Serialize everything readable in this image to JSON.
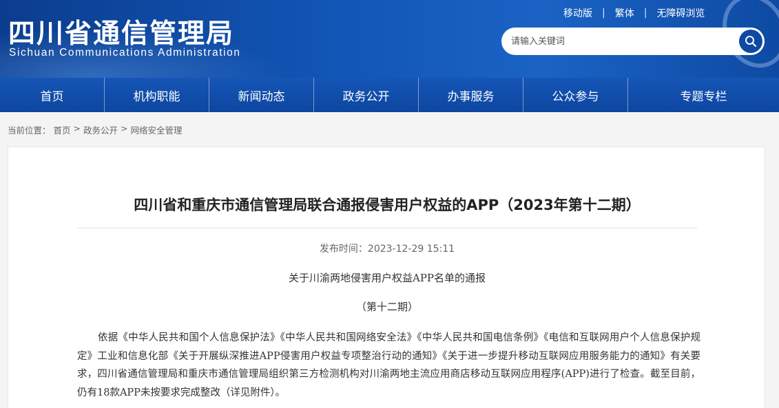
{
  "header": {
    "logo_cn": "四川省通信管理局",
    "logo_en": "Sichuan Communications Administration",
    "toplinks": [
      "移动版",
      "繁体",
      "无障碍浏览"
    ],
    "search_placeholder": "请输入关键词"
  },
  "nav": {
    "items": [
      "首页",
      "机构职能",
      "新闻动态",
      "政务公开",
      "办事服务",
      "公众参与",
      "专题专栏"
    ]
  },
  "breadcrumb": {
    "label": "当前位置：",
    "items": [
      "首页",
      "政务公开",
      "网络安全管理"
    ],
    "separator": ">"
  },
  "article": {
    "title": "四川省和重庆市通信管理局联合通报侵害用户权益的APP（2023年第十二期）",
    "pubtime": "发布时间：2023-12-29 15:11",
    "subtitle": "关于川渝两地侵害用户权益APP名单的通报",
    "issue": "（第十二期）",
    "paragraph": "依据《中华人民共和国个人信息保护法》《中华人民共和国网络安全法》《中华人民共和国电信条例》《电信和互联网用户个人信息保护规定》工业和信息化部《关于开展纵深推进APP侵害用户权益专项整治行动的通知》《关于进一步提升移动互联网应用服务能力的通知》有关要求，四川省通信管理局和重庆市通信管理局组织第三方检测机构对川渝两地主流应用商店移动互联网应用程序(APP)进行了检查。截至目前，仍有18款APP未按要求完成整改（详见附件）。"
  },
  "colors": {
    "header_blue": "#1257b8",
    "nav_blue": "#0d46a0"
  }
}
